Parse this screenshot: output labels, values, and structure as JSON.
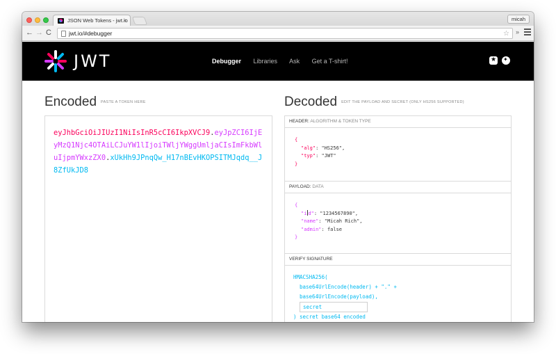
{
  "browser": {
    "tab_title": "JSON Web Tokens - jwt.io",
    "tab_close": "×",
    "profile_name": "micah",
    "url": "jwt.io/#debugger",
    "back_glyph": "←",
    "forward_glyph": "→",
    "reload_glyph": "C",
    "star_glyph": "☆",
    "ext_glyph": "»"
  },
  "nav": {
    "logo_text": "JWT",
    "links": [
      "Debugger",
      "Libraries",
      "Ask",
      "Get a T-shirt!"
    ],
    "active_link": "Debugger"
  },
  "encoded": {
    "title": "Encoded",
    "subtitle": "PASTE A TOKEN HERE",
    "token_header": "eyJhbGciOiJIUzI1NiIsInR5cCI6IkpXVCJ9",
    "token_payload": "eyJpZCI6IjEyMzQ1Njc4OTAiLCJuYW1lIjoiTWljYWggUmljaCIsImFkbWluIjpmYWxzZX0",
    "token_signature": "xUkHh9JPnqQw_H17nBEvHKOPSITMJqdq__J8ZfUkJD8",
    "dot": "."
  },
  "decoded": {
    "title": "Decoded",
    "subtitle": "EDIT THE PAYLOAD AND SECRET (ONLY HS256 SUPPORTED)",
    "header_panel": {
      "label": "HEADER:",
      "sub": "ALGORITHM & TOKEN TYPE",
      "open": "{",
      "close": "}",
      "lines": [
        {
          "key": "\"alg\"",
          "value": ": \"HS256\","
        },
        {
          "key": "\"typ\"",
          "value": ": \"JWT\""
        }
      ]
    },
    "payload_panel": {
      "label": "PAYLOAD:",
      "sub": "DATA",
      "open": "{",
      "close": "}",
      "lines": [
        {
          "key_pre": "\"i",
          "key_post": "d\"",
          "value": ": \"1234567890\","
        },
        {
          "key": "\"name\"",
          "value": ": \"Micah Rich\","
        },
        {
          "key": "\"admin\"",
          "value": ": false"
        }
      ]
    },
    "signature_panel": {
      "label": "VERIFY SIGNATURE",
      "fn": "HMACSHA256(",
      "line1": "base64UrlEncode(header) + \".\" +",
      "line2": "base64UrlEncode(payload),",
      "secret_value": "secret",
      "tail": ") secret base64 encoded"
    }
  }
}
